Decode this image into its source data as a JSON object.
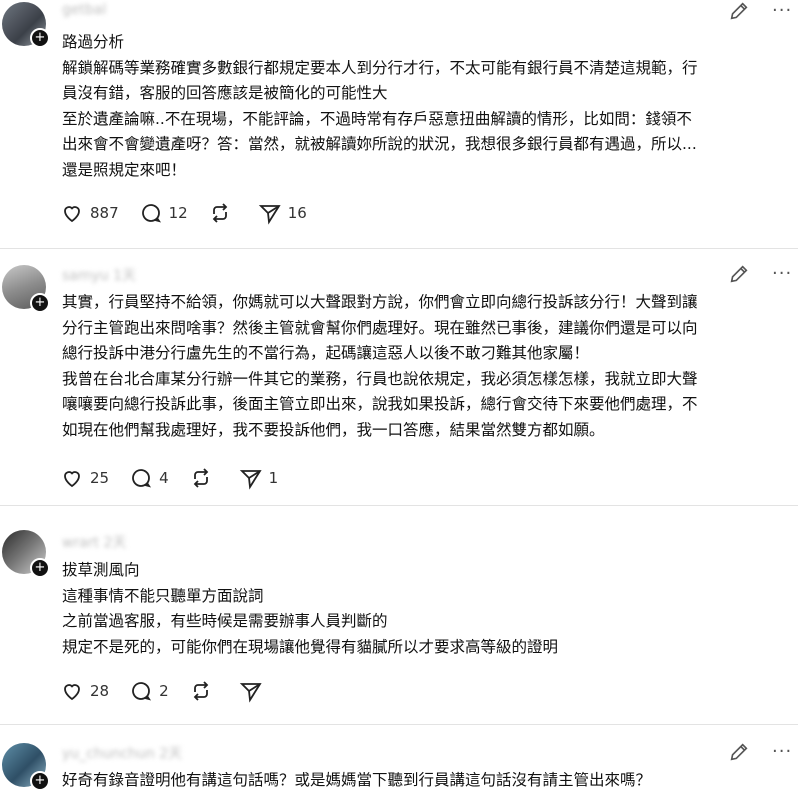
{
  "posts": [
    {
      "username": "getbal",
      "lines": [
        "路過分析",
        "解鎖解碼等業務確實多數銀行都規定要本人到分行才行，不太可能有銀行員不清楚這規範，行",
        "員沒有錯，客服的回答應該是被簡化的可能性大",
        "至於遺產論嘛..不在現場，不能評論，不過時常有存戶惡意扭曲解讀的情形，比如問：錢領不",
        "出來會不會變遺產呀？答：當然，就被解讀妳所說的狀況，我想很多銀行員都有遇過，所以...",
        "還是照規定來吧！"
      ],
      "likes": "887",
      "replies": "12",
      "reposts": "",
      "shares": "16"
    },
    {
      "username": "samyu 1天",
      "lines": [
        "其實，行員堅持不給領，你媽就可以大聲跟對方說，你們會立即向總行投訴該分行！大聲到讓",
        "分行主管跑出來問啥事？然後主管就會幫你們處理好。現在雖然已事後，建議你們還是可以向",
        "總行投訴中港分行盧先生的不當行為，起碼讓這惡人以後不敢刁難其他家屬！",
        "我曾在台北合庫某分行辦一件其它的業務，行員也說依規定，我必須怎樣怎樣，我就立即大聲",
        "嚷嚷要向總行投訴此事，後面主管立即出來，說我如果投訴，總行會交待下來要他們處理，不",
        "如現在他們幫我處理好，我不要投訴他們，我一口答應，結果當然雙方都如願。"
      ],
      "likes": "25",
      "replies": "4",
      "reposts": "",
      "shares": "1"
    },
    {
      "username": "wrart 2天",
      "lines": [
        "拔草測風向",
        "這種事情不能只聽單方面說詞",
        "之前當過客服，有些時候是需要辦事人員判斷的",
        "規定不是死的，可能你們在現場讓他覺得有貓膩所以才要求高等級的證明"
      ],
      "likes": "28",
      "replies": "2",
      "reposts": "",
      "shares": ""
    },
    {
      "username": "yu_chunchun 2天",
      "lines": [
        "好奇有錄音證明他有講這句話嗎？或是媽媽當下聽到行員講這句話沒有請主管出來嗎？"
      ]
    }
  ],
  "icons": {
    "edit": "pencil-icon",
    "more": "more-icon",
    "like": "heart-icon",
    "reply": "comment-icon",
    "repost": "repost-icon",
    "share": "send-icon",
    "follow": "plus-icon"
  },
  "more_glyph": "···",
  "plus_glyph": "+"
}
